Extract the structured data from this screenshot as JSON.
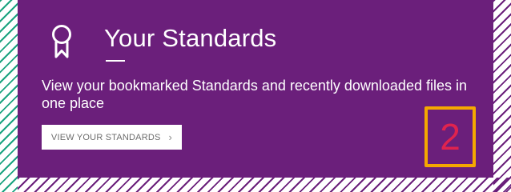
{
  "card": {
    "title": "Your Standards",
    "description": "View your bookmarked Standards and recently downloaded files in one place",
    "cta_label": "VIEW YOUR STANDARDS",
    "cta_chevron": "›"
  },
  "annotation": {
    "number": "2",
    "box_color": "#f5a800",
    "number_color": "#e0234e"
  },
  "icons": {
    "ribbon": "award-ribbon-icon",
    "chevron": "chevron-right-icon"
  },
  "colors": {
    "card_background": "#6b1f7b",
    "left_hatch": "#1aa37f",
    "right_bottom_hatch": "#6a1f7a"
  }
}
